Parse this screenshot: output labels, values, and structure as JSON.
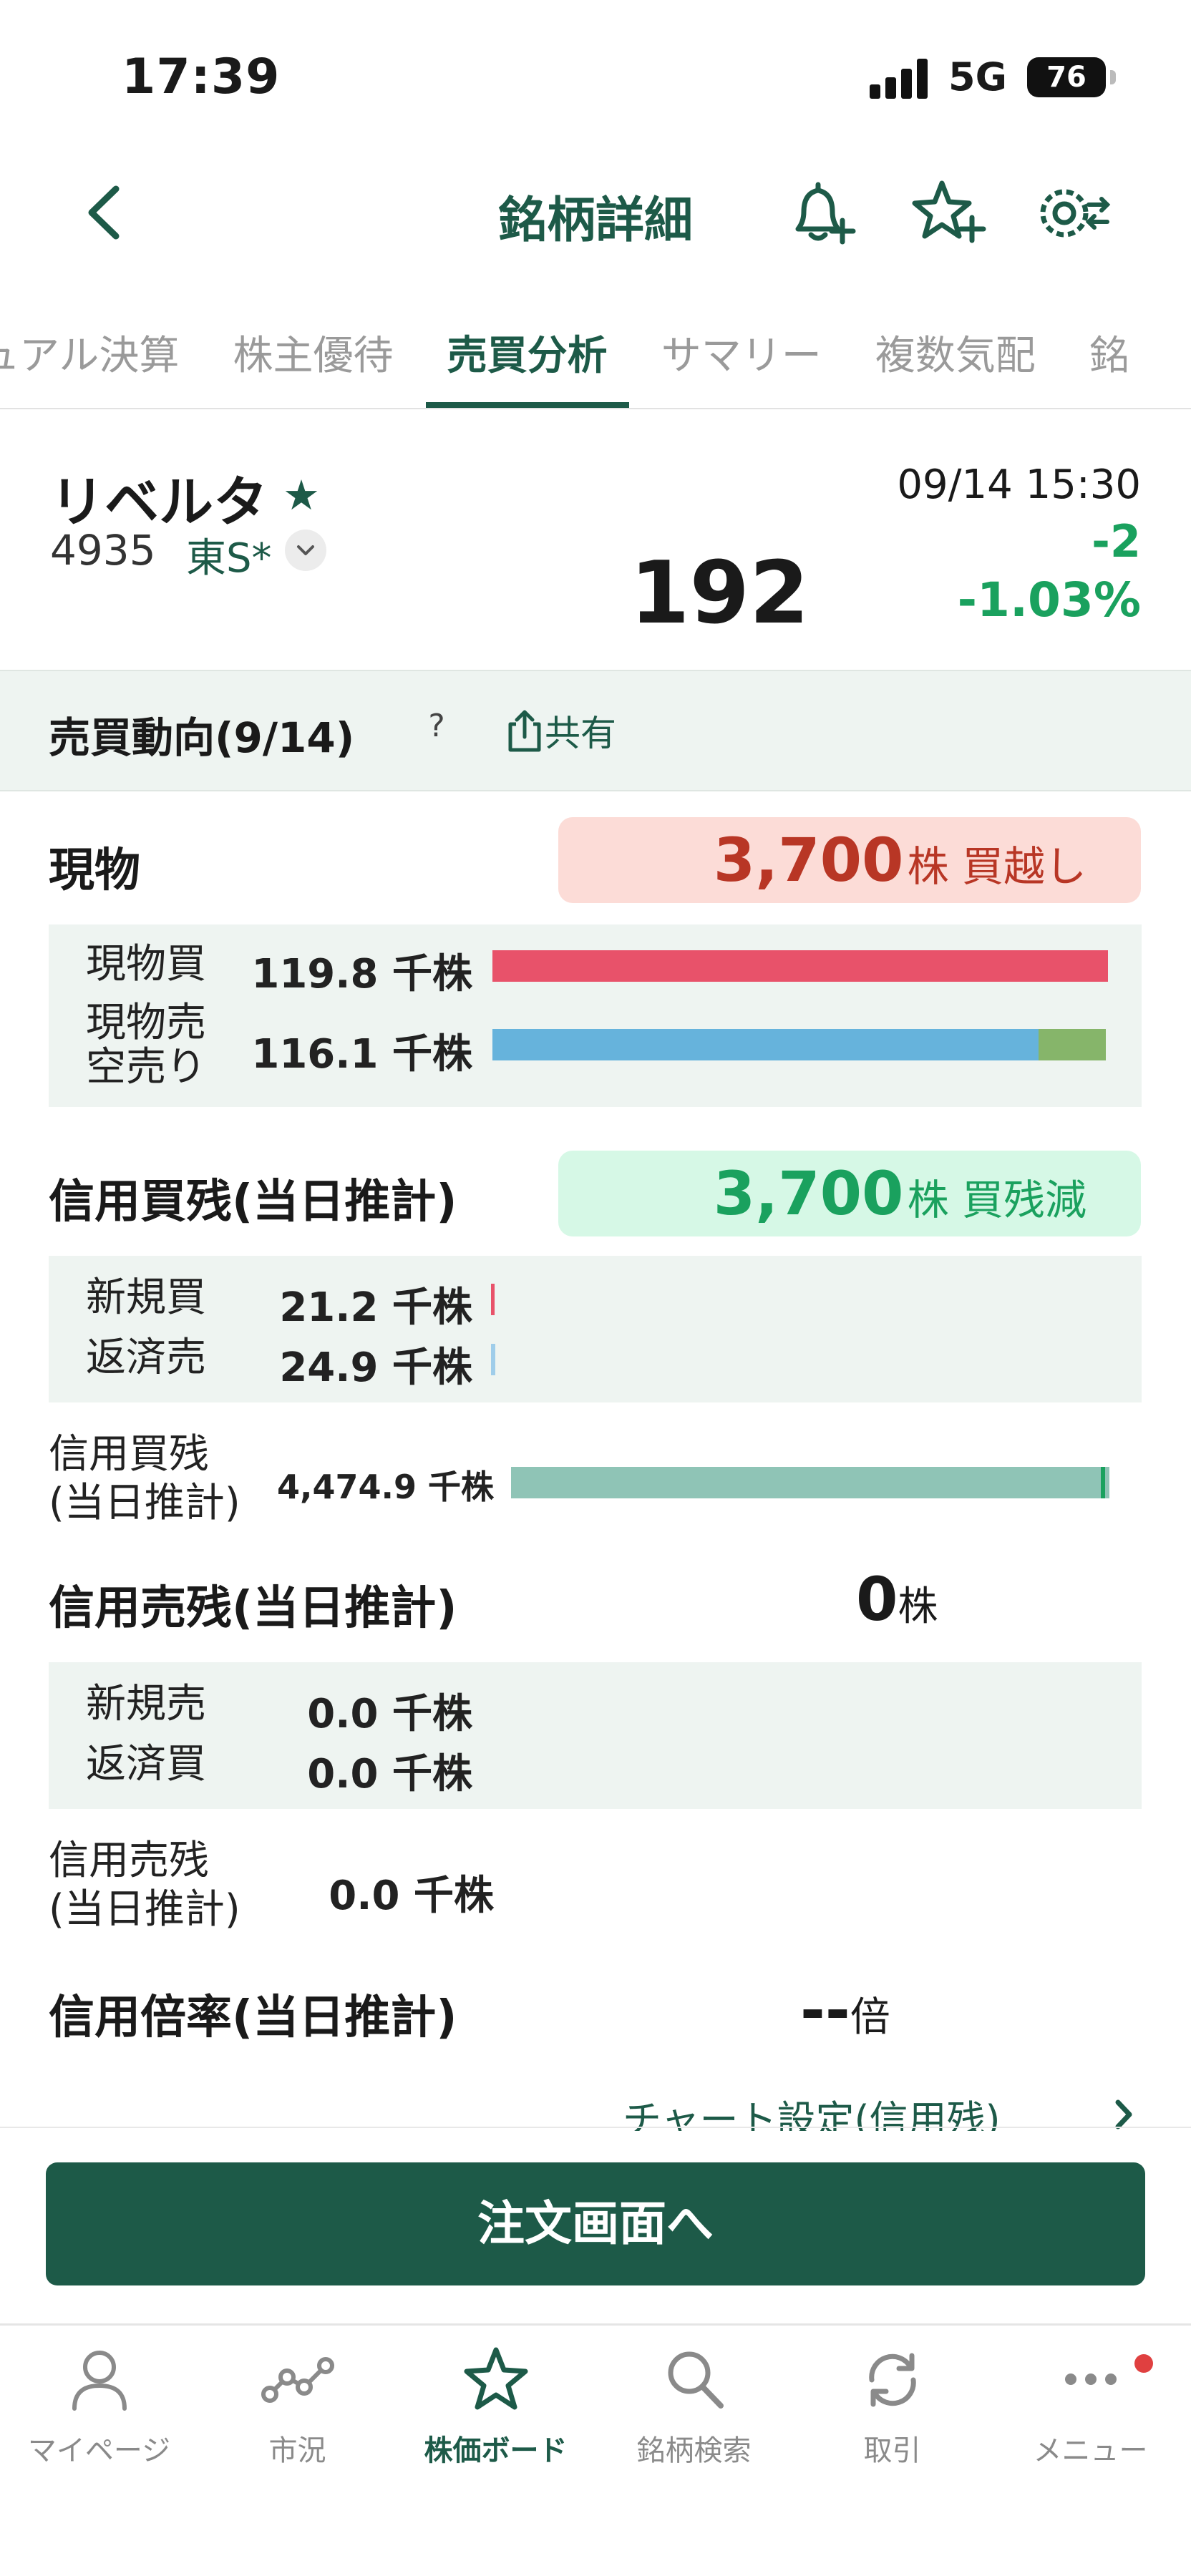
{
  "status_bar": {
    "time": "17:39",
    "network": "5G",
    "battery": "76"
  },
  "nav": {
    "title": "銘柄詳細"
  },
  "tabs": [
    "ジュアル決算",
    "株主優待",
    "売買分析",
    "サマリー",
    "複数気配",
    "銘"
  ],
  "stock": {
    "name": "リベルタ",
    "code": "4935",
    "market": "東S*",
    "datetime": "09/14 15:30",
    "price": "192",
    "change": "-2",
    "change_pct": "-1.03%"
  },
  "section": {
    "title": "売買動向(9/14)",
    "help": "?",
    "share": "共有"
  },
  "spot": {
    "label": "現物",
    "badge_value": "3,700",
    "badge_unit": "株 買越し",
    "buy_label": "現物買",
    "buy_value": "119.8 千株",
    "buy_ratio": 1.0,
    "sell_label_1": "現物売",
    "sell_label_2": "空売り",
    "sell_value": "116.1 千株",
    "sell_spot_ratio": 0.887,
    "sell_short_ratio": 0.11
  },
  "margin_buy": {
    "label": "信用買残(当日推計)",
    "badge_value": "3,700",
    "badge_unit": "株 買残減",
    "new_buy_label": "新規買",
    "new_buy_value": "21.2 千株",
    "repay_sell_label": "返済売",
    "repay_sell_value": "24.9 千株",
    "balance_label_1": "信用買残",
    "balance_label_2": "(当日推計)",
    "balance_value": "4,474.9 千株"
  },
  "margin_sell": {
    "label": "信用売残(当日推計)",
    "value": "0",
    "unit": "株",
    "new_sell_label": "新規売",
    "new_sell_value": "0.0 千株",
    "repay_buy_label": "返済買",
    "repay_buy_value": "0.0 千株",
    "balance_label_1": "信用売残",
    "balance_label_2": "(当日推計)",
    "balance_value": "0.0 千株"
  },
  "margin_ratio": {
    "label": "信用倍率(当日推計)",
    "value": "--",
    "unit": "倍"
  },
  "chart_link": "チャート設定(信用残)",
  "order_button": "注文画面へ",
  "bottom_tabs": [
    "マイページ",
    "市況",
    "株価ボード",
    "銘柄検索",
    "取引",
    "メニュー"
  ],
  "colors": {
    "brand": "#1d5a48",
    "up_red": "#b83625",
    "down_green": "#1aa15e",
    "buy_bar": "#e8526a",
    "sell_bar": "#66b3dc",
    "short_bar": "#86b56a",
    "balance_bar": "#8fc4b6"
  }
}
